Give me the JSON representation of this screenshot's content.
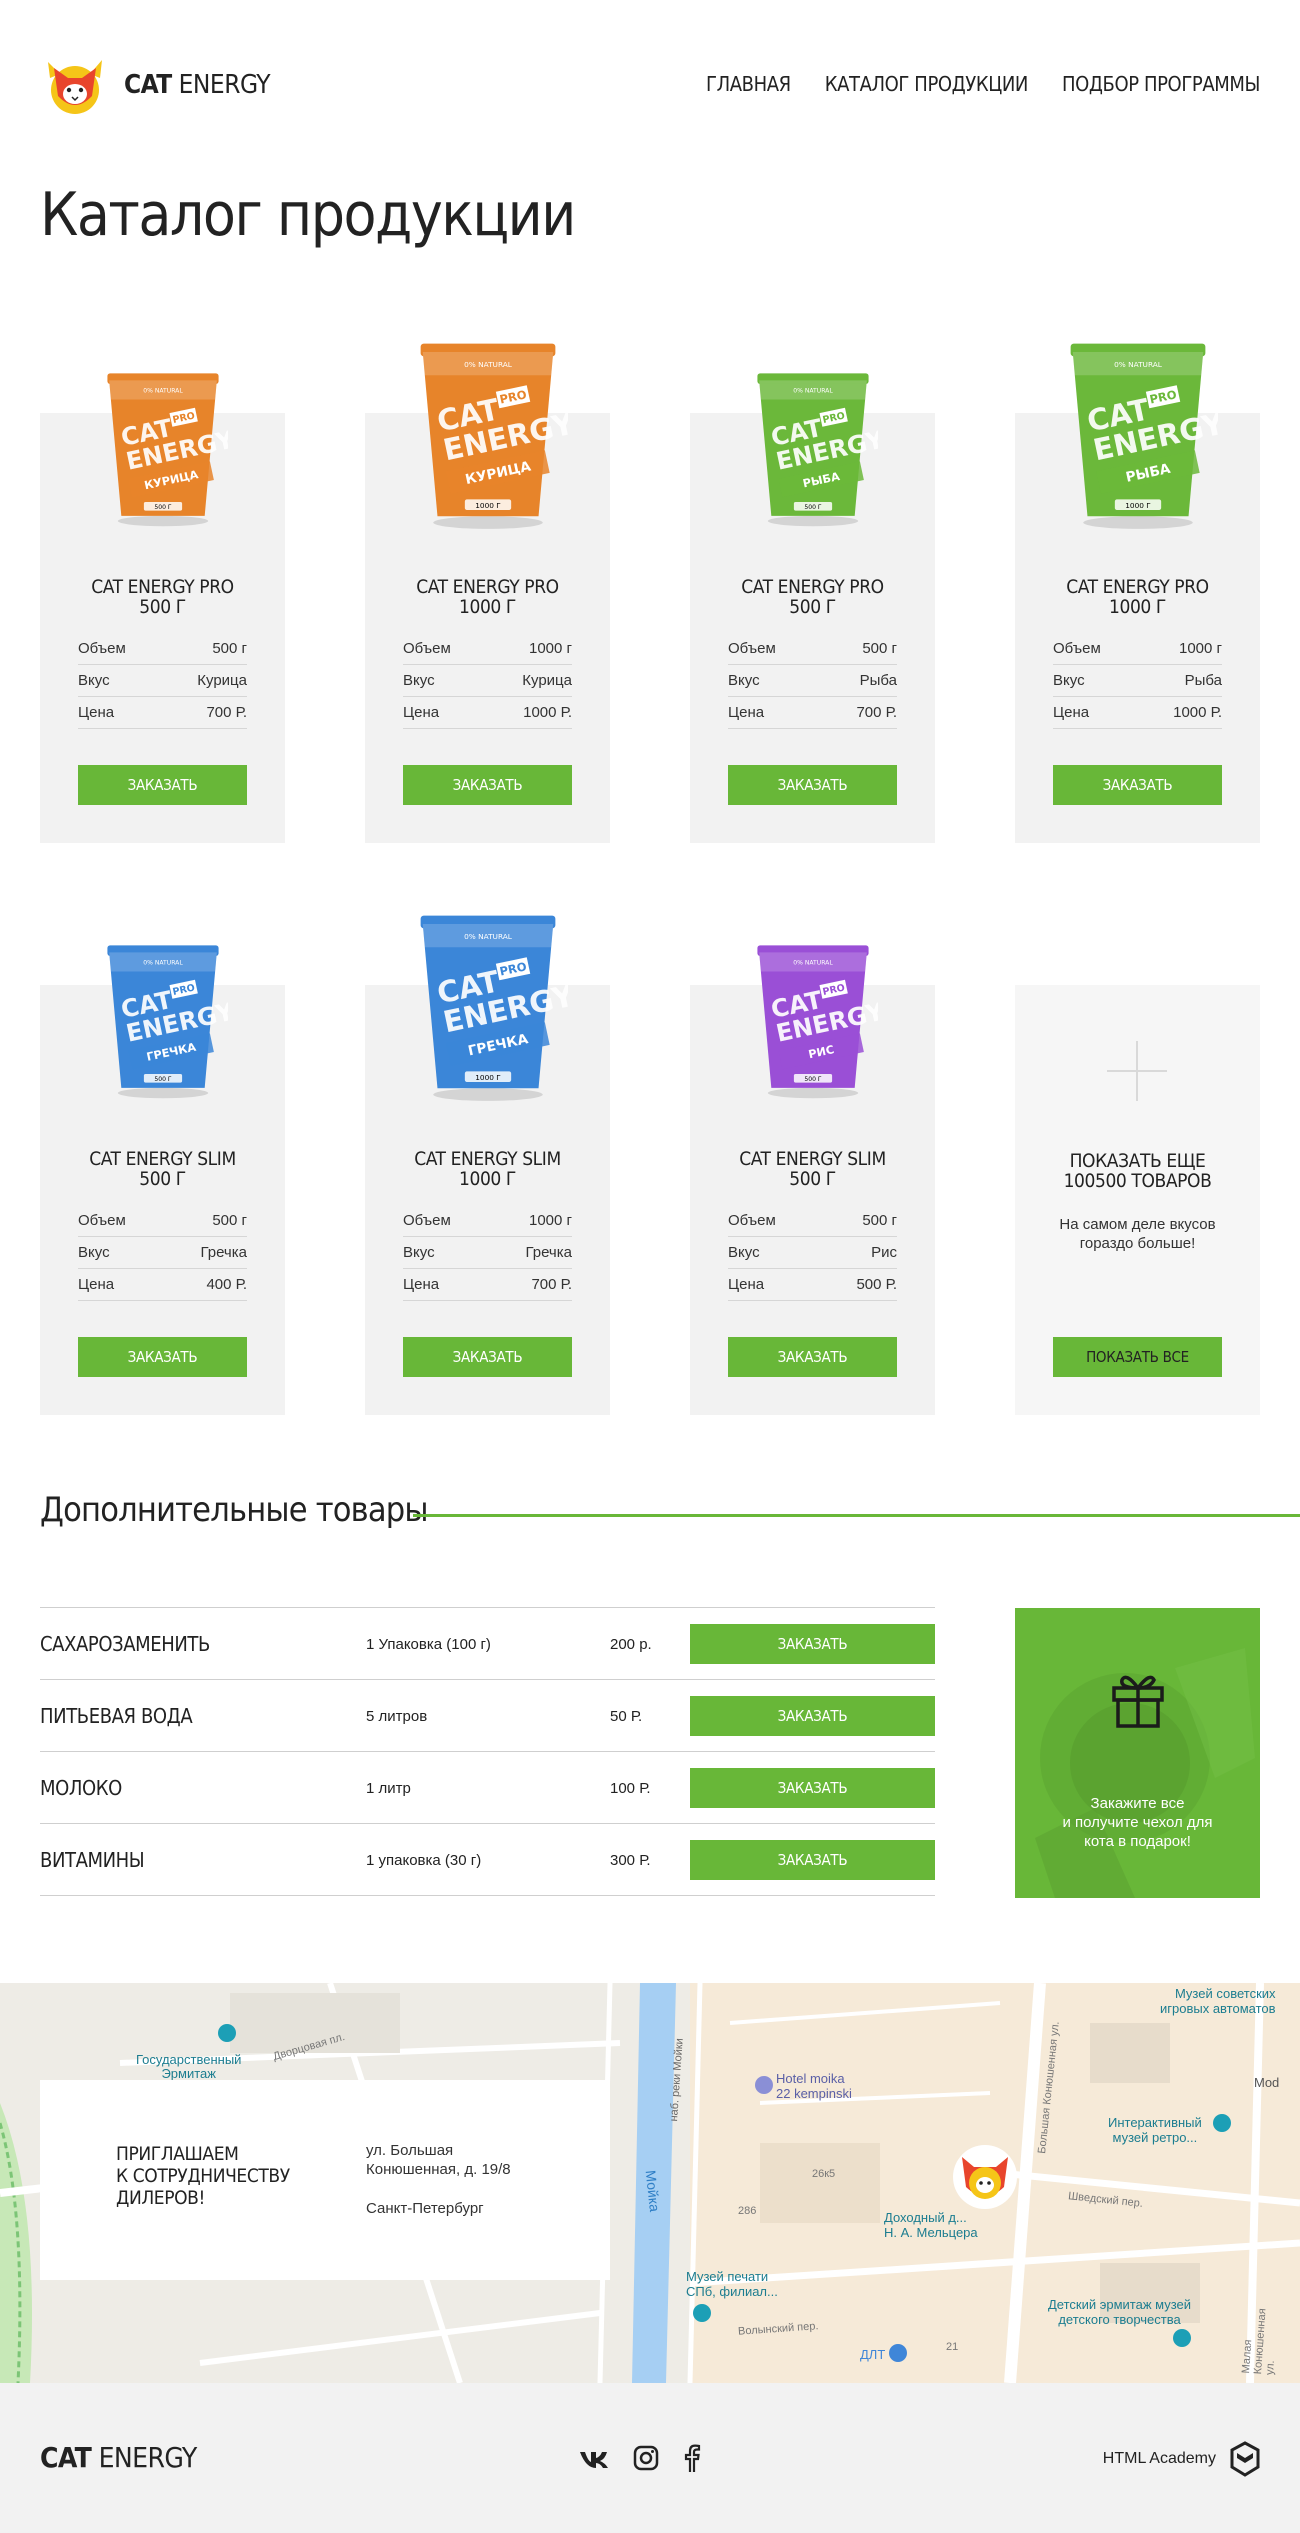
{
  "header": {
    "logo_bold": "CAT",
    "logo_light": "ENERGY",
    "nav": [
      "ГЛАВНАЯ",
      "КАТАЛОГ ПРОДУКЦИИ",
      "ПОДБОР ПРОГРАММЫ"
    ]
  },
  "page_title": "Каталог продукции",
  "spec_labels": {
    "volume": "Объем",
    "taste": "Вкус",
    "price": "Цена"
  },
  "order_label": "ЗАКАЗАТЬ",
  "cup_brand": [
    "CAT",
    "ENERGY"
  ],
  "cup_badge": "PRO",
  "cup_natural": "0% NATURAL",
  "products": [
    {
      "name_1": "CAT ENERGY PRO",
      "name_2": "500 Г",
      "volume": "500 г",
      "taste": "Курица",
      "price": "700 Р.",
      "cup_flavor": "КУРИЦА",
      "cup_weight": "500 Г",
      "color": "#e7842a"
    },
    {
      "name_1": "CAT ENERGY PRO",
      "name_2": "1000 Г",
      "volume": "1000 г",
      "taste": "Курица",
      "price": "1000 Р.",
      "cup_flavor": "КУРИЦА",
      "cup_weight": "1000 Г",
      "color": "#e7842a"
    },
    {
      "name_1": "CAT ENERGY PRO",
      "name_2": "500 Г",
      "volume": "500 г",
      "taste": "Рыба",
      "price": "700 Р.",
      "cup_flavor": "РЫБА",
      "cup_weight": "500 Г",
      "color": "#6bb83a"
    },
    {
      "name_1": "CAT ENERGY PRO",
      "name_2": "1000 Г",
      "volume": "1000 г",
      "taste": "Рыба",
      "price": "1000 Р.",
      "cup_flavor": "РЫБА",
      "cup_weight": "1000 Г",
      "color": "#6bb83a"
    },
    {
      "name_1": "CAT ENERGY SLIM",
      "name_2": "500 Г",
      "volume": "500 г",
      "taste": "Гречка",
      "price": "400 Р.",
      "cup_flavor": "ГРЕЧКА",
      "cup_weight": "500 Г",
      "color": "#3b86d8"
    },
    {
      "name_1": "CAT ENERGY SLIM",
      "name_2": "1000 Г",
      "volume": "1000 г",
      "taste": "Гречка",
      "price": "700 Р.",
      "cup_flavor": "ГРЕЧКА",
      "cup_weight": "1000 Г",
      "color": "#3b86d8"
    },
    {
      "name_1": "CAT ENERGY SLIM",
      "name_2": "500 Г",
      "volume": "500 г",
      "taste": "Рис",
      "price": "500 Р.",
      "cup_flavor": "РИС",
      "cup_weight": "500 Г",
      "color": "#9a4fd6"
    }
  ],
  "show_more": {
    "title_1": "ПОКАЗАТЬ ЕЩЕ",
    "title_2": "100500 ТОВАРОВ",
    "text_1": "На самом деле вкусов",
    "text_2": "гораздо больше!",
    "button": "ПОКАЗАТЬ ВСЕ"
  },
  "additional": {
    "title": "Дополнительные товары",
    "rows": [
      {
        "name": "САХАРОЗАМЕНИТЬ",
        "qty": "1 Упаковка (100 г)",
        "price": "200 р."
      },
      {
        "name": "ПИТЬЕВАЯ ВОДА",
        "qty": "5 литров",
        "price": "50 Р."
      },
      {
        "name": "МОЛОКО",
        "qty": "1 литр",
        "price": "100 Р."
      },
      {
        "name": "ВИТАМИНЫ",
        "qty": "1 упаковка (30 г)",
        "price": "300 Р."
      }
    ],
    "gift_1": "Закажите все",
    "gift_2": "и получите чехол для",
    "gift_3": "кота в подарок!"
  },
  "dealer": {
    "title_1": "ПРИГЛАШАЕМ",
    "title_2": "К СОТРУДНИЧЕСТВУ",
    "title_3": "ДИЛЕРОВ!",
    "addr_1": "ул. Большая",
    "addr_2": "Конюшенная, д. 19/8",
    "city": "Санкт-Петербург"
  },
  "map_labels": {
    "hermitage_1": "Государственный",
    "hermitage_2": "Эрмитаж",
    "hotel_1": "Hotel moika",
    "hotel_2": "22 kempinski",
    "museum_1": "Музей советских",
    "museum_2": "игровых автоматов",
    "retro_1": "Интерактивный",
    "retro_2": "музей ретро...",
    "moika": "Мойка",
    "print_1": "Музей печати",
    "print_2": "СПб, филиал...",
    "house_1": "Доходный д...",
    "house_2": "Н. А. Мельцера",
    "kids_1": "Детский эрмитаж музей",
    "kids_2": "детского творчества",
    "dlt": "ДЛТ",
    "nab_1": "наб. реки Мойки",
    "dvorc": "Дворцовая пл.",
    "shved": "Шведский пер.",
    "volyn": "Волынский пер.",
    "bkon": "Большая Конюшенная ул.",
    "mkon": "Малая Конюшенная ул.",
    "num_1": "286",
    "num_2": "26к5",
    "num_3": "21",
    "mod": "Mod"
  },
  "footer": {
    "logo_bold": "CAT",
    "logo_light": "ENERGY",
    "academy": "HTML Academy"
  },
  "colors": {
    "accent": "#68b738",
    "card_bg": "#f2f2f2",
    "footer_bg": "#f2f2f2"
  }
}
